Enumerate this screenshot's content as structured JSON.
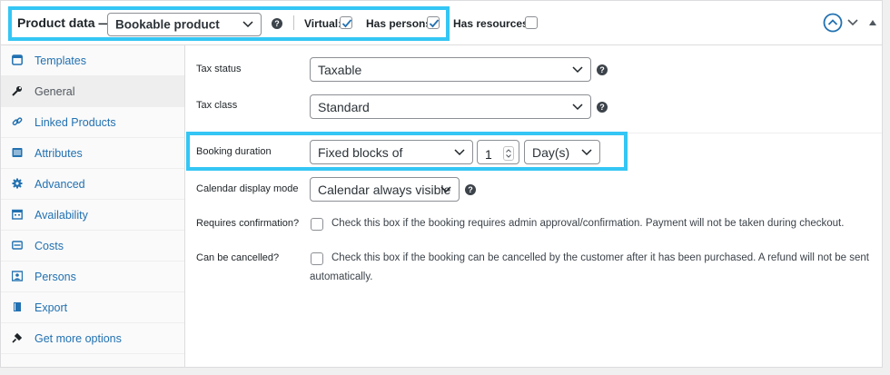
{
  "header": {
    "title": "Product data —",
    "product_type": "Bookable product",
    "help": "?",
    "virtual_label": "Virtual:",
    "virtual_checked": true,
    "persons_label": "Has persons:",
    "persons_checked": true,
    "resources_label": "Has resources:",
    "resources_checked": false
  },
  "sidebar": {
    "items": [
      {
        "label": "Templates",
        "icon": "window-icon"
      },
      {
        "label": "General",
        "icon": "wrench-icon",
        "active": true
      },
      {
        "label": "Linked Products",
        "icon": "link-icon"
      },
      {
        "label": "Attributes",
        "icon": "list-icon"
      },
      {
        "label": "Advanced",
        "icon": "gear-icon"
      },
      {
        "label": "Availability",
        "icon": "calendar-icon"
      },
      {
        "label": "Costs",
        "icon": "money-icon"
      },
      {
        "label": "Persons",
        "icon": "person-card-icon"
      },
      {
        "label": "Export",
        "icon": "export-icon"
      },
      {
        "label": "Get more options",
        "icon": "plugin-icon"
      }
    ]
  },
  "fields": {
    "tax_status": {
      "label": "Tax status",
      "value": "Taxable"
    },
    "tax_class": {
      "label": "Tax class",
      "value": "Standard"
    },
    "booking_duration": {
      "label": "Booking duration",
      "type": "Fixed blocks of",
      "amount": "1",
      "unit": "Day(s)"
    },
    "calendar_mode": {
      "label": "Calendar display mode",
      "value": "Calendar always visible"
    },
    "requires_confirmation": {
      "label": "Requires confirmation?",
      "description": "Check this box if the booking requires admin approval/confirmation. Payment will not be taken during checkout."
    },
    "can_be_cancelled": {
      "label": "Can be cancelled?",
      "description_line1": "Check this box if the booking can be cancelled by the customer after it has been purchased. A refund will not be sent",
      "description_line2": "automatically."
    }
  },
  "colors": {
    "highlight": "#34c6f4",
    "link": "#2271b1"
  }
}
